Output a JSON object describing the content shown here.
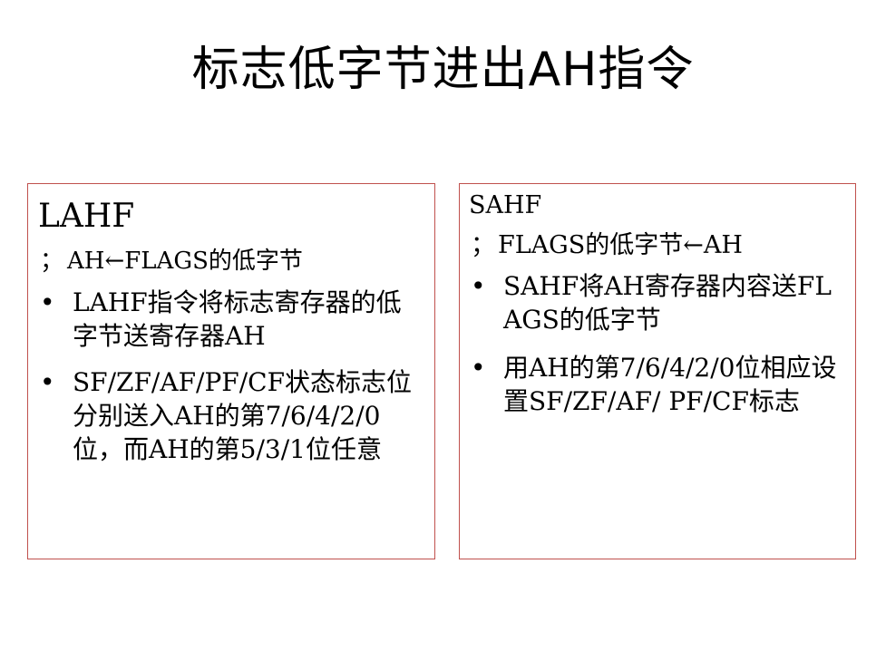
{
  "slide": {
    "title": "标志低字节进出AH指令"
  },
  "left_panel": {
    "heading": "LAHF",
    "comment_mark": "；",
    "comment_text": "AH←FLAGS的低字节",
    "bullet_symbol": "•",
    "bullets": [
      {
        "text": "LAHF指令将标志寄存器的低字节送寄存器AH"
      },
      {
        "text": "SF/ZF/AF/PF/CF状态标志位分别送入AH的第7/6/4/2/0位，而AH的第5/3/1位任意"
      }
    ]
  },
  "right_panel": {
    "heading": "SAHF",
    "comment_mark": "；",
    "comment_text": "FLAGS的低字节←AH",
    "bullet_symbol": "•",
    "bullets": [
      {
        "text": "SAHF将AH寄存器内容送FLAGS的低字节"
      },
      {
        "text": "用AH的第7/6/4/2/0位相应设置SF/ZF/AF/ PF/CF标志"
      }
    ]
  },
  "colors": {
    "panel_border": "#c0504d",
    "text": "#000000",
    "background": "#ffffff"
  }
}
